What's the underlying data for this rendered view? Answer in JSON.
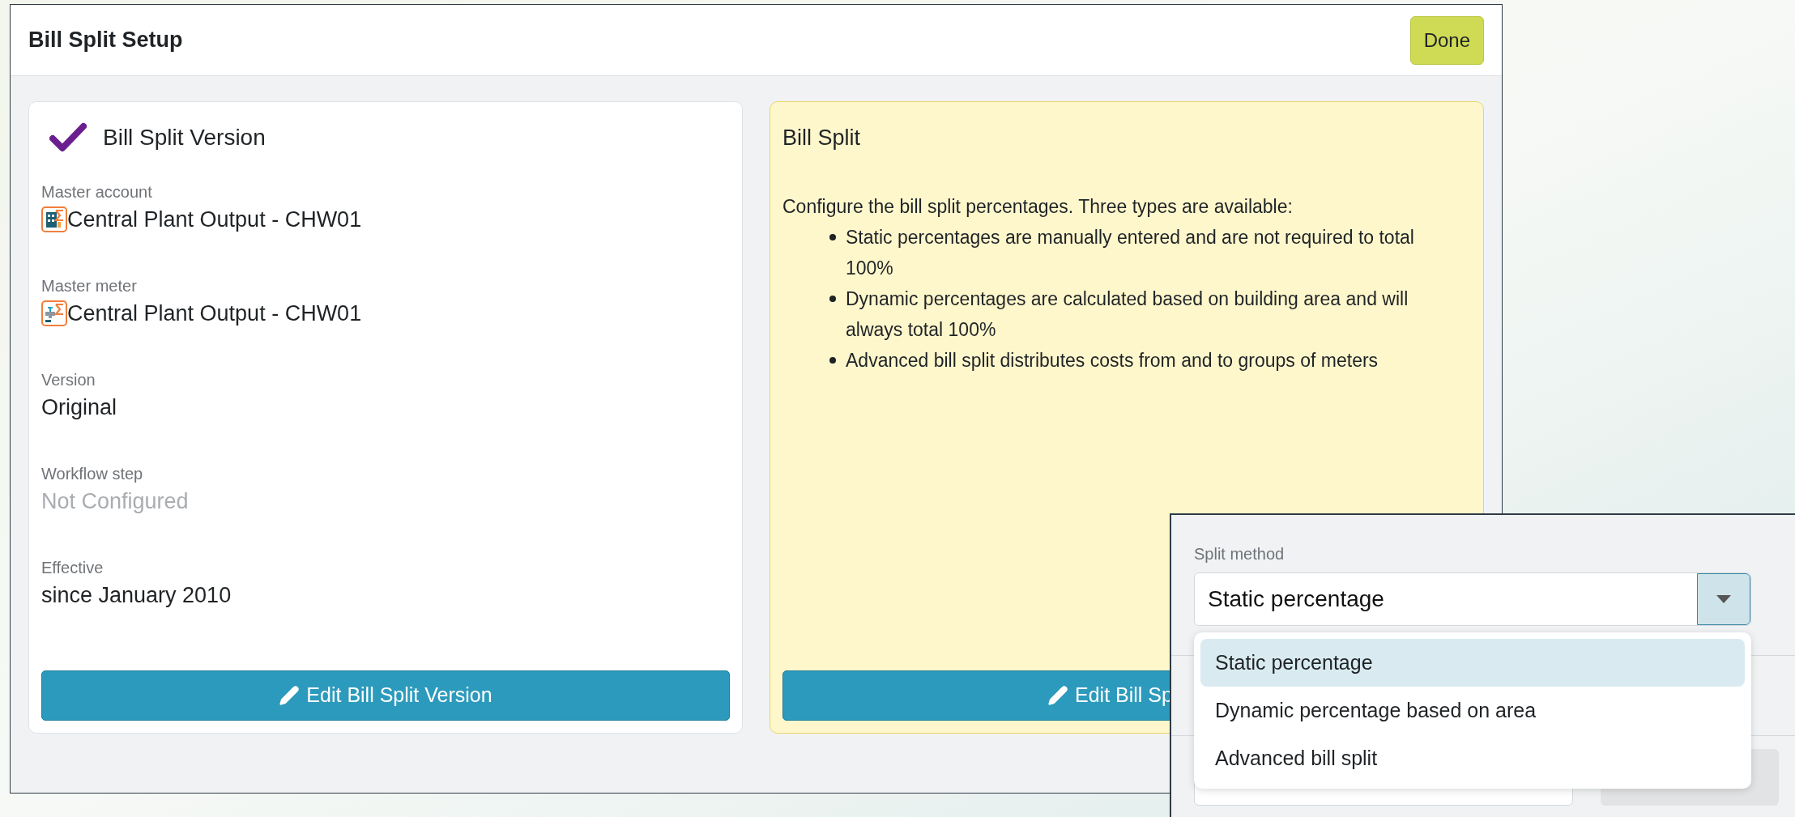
{
  "window": {
    "title": "Bill Split Setup",
    "done_button": "Done"
  },
  "version_card": {
    "title": "Bill Split Version",
    "complete": true,
    "button": "Edit Bill Split Version",
    "fields": [
      {
        "label": "Master account",
        "value": "Central Plant Output - CHW01",
        "kind": "account",
        "disabled": false
      },
      {
        "label": "Master meter",
        "value": "Central Plant Output - CHW01",
        "kind": "meter",
        "disabled": false
      },
      {
        "label": "Version",
        "value": "Original",
        "kind": "text",
        "disabled": false
      },
      {
        "label": "Workflow step",
        "value": "Not Configured",
        "kind": "text",
        "disabled": true
      },
      {
        "label": "Effective",
        "value": "since January 2010",
        "kind": "text",
        "disabled": false
      }
    ]
  },
  "info_card": {
    "title": "Bill Split",
    "intro": "Configure the bill split percentages. Three types are available:",
    "bullets": [
      "Static percentages are manually entered and are not required to total 100%",
      "Dynamic percentages are calculated based on building area and will always total 100%",
      "Advanced bill split distributes costs from and to groups of meters"
    ],
    "button": "Edit Bill Sp"
  },
  "split_popup": {
    "label": "Split method",
    "value": "Static percentage",
    "options": [
      {
        "label": "Static percentage",
        "selected": true
      },
      {
        "label": "Dynamic percentage based on area",
        "selected": false
      },
      {
        "label": "Advanced bill split",
        "selected": false
      }
    ]
  }
}
